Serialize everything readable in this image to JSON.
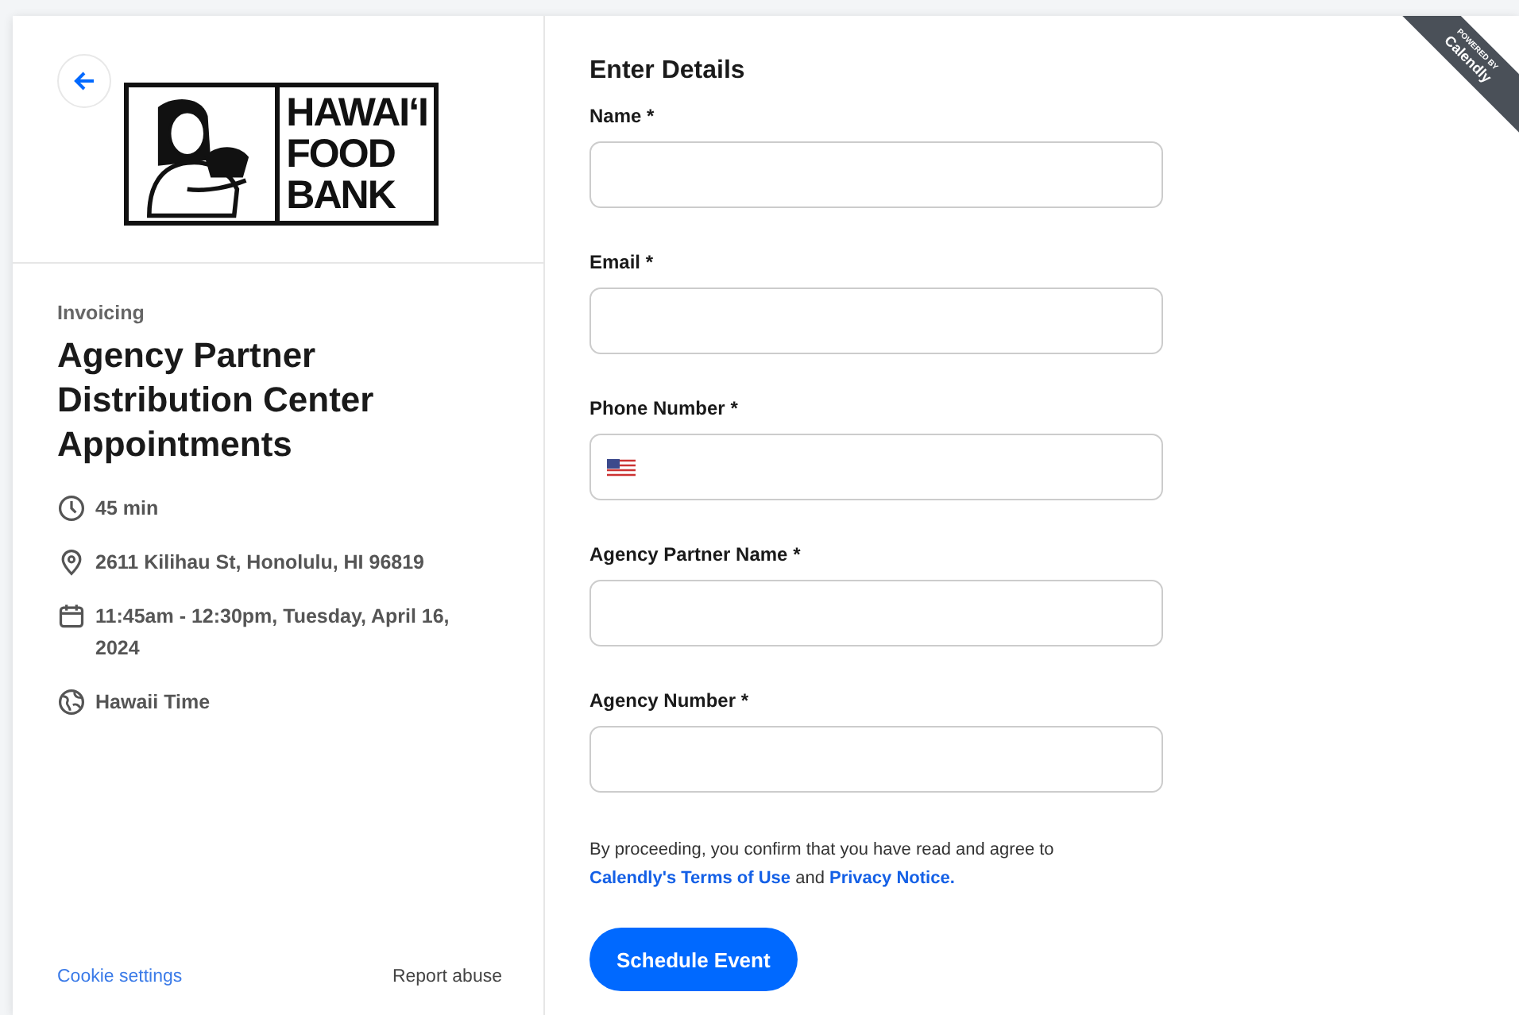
{
  "logo": {
    "lines": [
      "HAWAIʻI",
      "FOOD",
      "BANK"
    ]
  },
  "event": {
    "owner": "Invoicing",
    "title": "Agency Partner Distribution Center Appointments",
    "details": [
      {
        "kind": "duration",
        "text": "45 min"
      },
      {
        "kind": "location",
        "text": "2611 Kilihau St, Honolulu, HI 96819"
      },
      {
        "kind": "date",
        "text": "11:45am - 12:30pm, Tuesday, April 16, 2024"
      },
      {
        "kind": "timezone",
        "text": "Hawaii Time"
      }
    ]
  },
  "footer": {
    "cookie_link": "Cookie settings",
    "report_link": "Report abuse"
  },
  "form": {
    "heading": "Enter Details",
    "fields": [
      {
        "label": "Name",
        "required": "*",
        "kind": "text"
      },
      {
        "label": "Email",
        "required": "*",
        "kind": "text"
      },
      {
        "label": "Phone Number",
        "required": "*",
        "kind": "phone"
      },
      {
        "label": "Agency Partner Name",
        "required": "*",
        "kind": "text"
      },
      {
        "label": "Agency Number",
        "required": "*",
        "kind": "text"
      }
    ],
    "consent": "By proceeding, you confirm that you have read and agree to",
    "terms_link": "Calendly's Terms of Use",
    "conjunction": "and",
    "privacy_link": "Privacy Notice.",
    "submit": "Schedule Event"
  },
  "ribbon": {
    "small": "POWERED BY",
    "brand": "Calendly"
  }
}
